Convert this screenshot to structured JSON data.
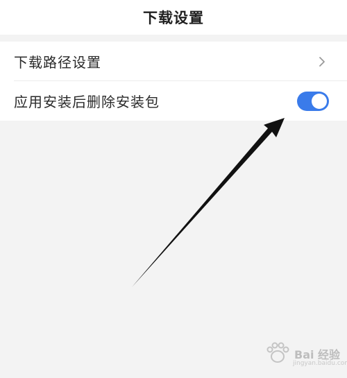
{
  "header": {
    "title": "下载设置"
  },
  "settings": {
    "items": [
      {
        "label": "下载路径设置",
        "control": "chevron-right-icon"
      },
      {
        "label": "应用安装后删除安装包",
        "control": "toggle",
        "toggle_on": true
      }
    ]
  },
  "colors": {
    "toggle_on": "#3a7bea",
    "background": "#f3f3f3",
    "surface": "#ffffff"
  },
  "watermark": {
    "text": "Bai 经验",
    "sub": "jingyan.baidu.com"
  }
}
